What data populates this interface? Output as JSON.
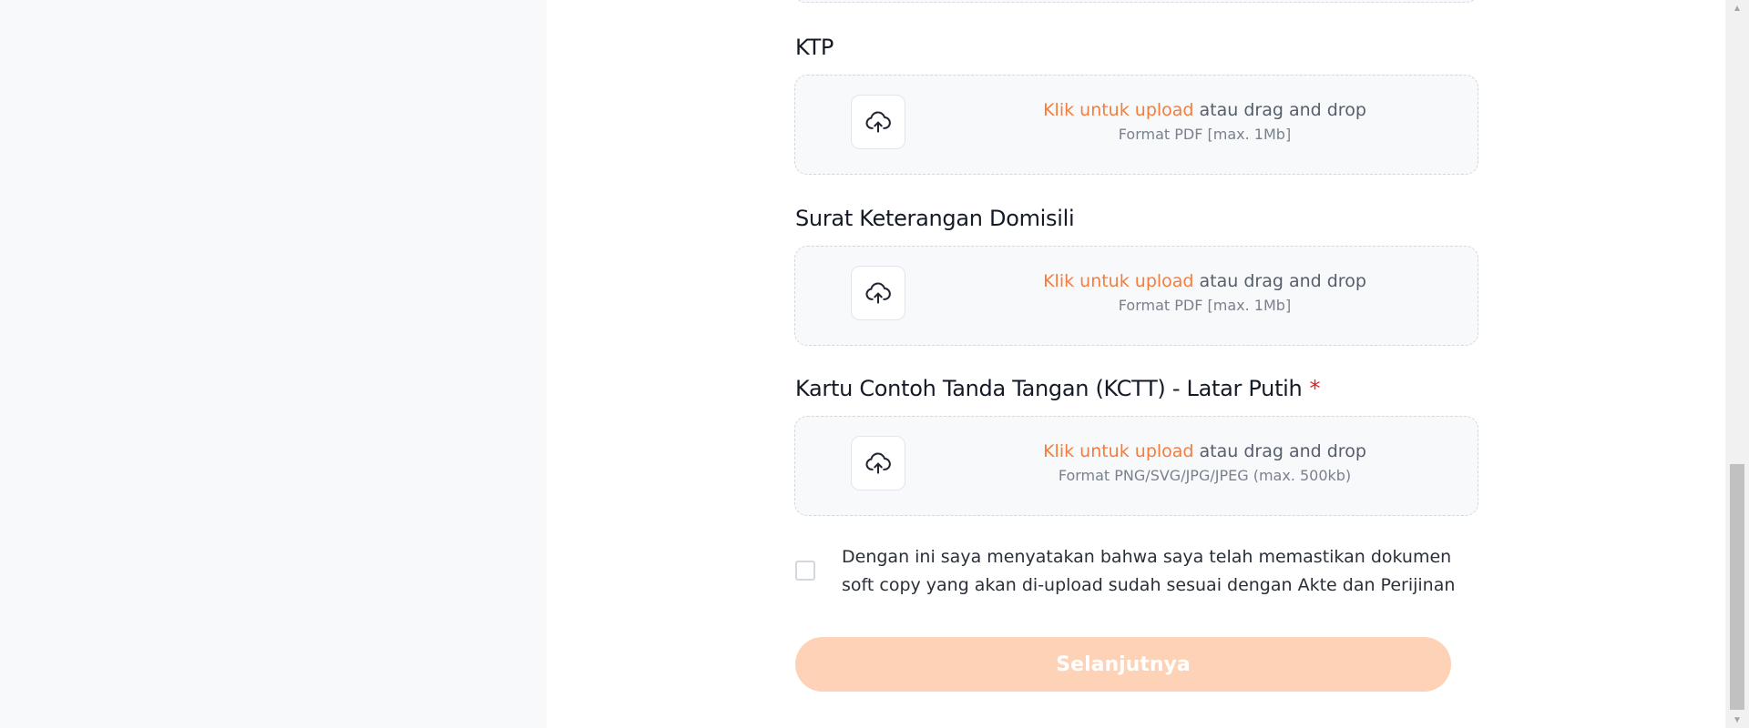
{
  "form": {
    "sections": [
      {
        "label": "KTP",
        "required": false,
        "upload_link": "Klik untuk upload",
        "upload_rest": "atau drag and drop",
        "format_hint": "Format PDF [max. 1Mb]"
      },
      {
        "label": "Surat Keterangan Domisili",
        "required": false,
        "upload_link": "Klik untuk upload",
        "upload_rest": "atau drag and drop",
        "format_hint": "Format PDF [max. 1Mb]"
      },
      {
        "label": "Kartu Contoh Tanda Tangan (KCTT) - Latar Putih",
        "required": true,
        "required_mark": "*",
        "upload_link": "Klik untuk upload",
        "upload_rest": "atau drag and drop",
        "format_hint": "Format PNG/SVG/JPG/JPEG (max. 500kb)"
      }
    ],
    "agreement": {
      "checked": false,
      "text_line1": "Dengan ini saya menyatakan bahwa saya telah memastikan dokumen",
      "text_line2": "soft copy yang akan di-upload sudah sesuai dengan Akte dan Perijinan"
    },
    "next_button_label": "Selanjutnya",
    "next_button_disabled": true
  },
  "icons": {
    "upload": "cloud-upload-icon",
    "scroll_up": "scroll-up-arrow-icon",
    "scroll_down": "scroll-down-arrow-icon"
  },
  "colors": {
    "accent": "#f47c3c",
    "button_disabled_bg": "#fdd2b7",
    "required": "#e02424",
    "dropzone_bg": "#f8f9fb",
    "dropzone_border": "#d3d7de"
  }
}
